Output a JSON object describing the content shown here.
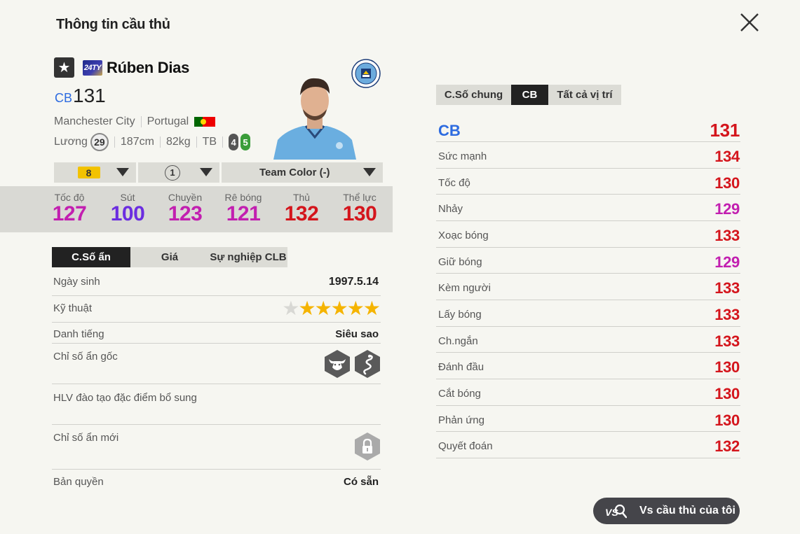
{
  "header": {
    "title": "Thông tin cầu thủ"
  },
  "player": {
    "name": "Rúben Dias",
    "season_badge": "24TY",
    "position": "CB",
    "ovr": "131",
    "club": "Manchester City",
    "nation": "Portugal",
    "salary_label": "Lương",
    "salary": "29",
    "height": "187cm",
    "weight": "82kg",
    "body_type": "TB",
    "left_foot": "4",
    "right_foot": "5"
  },
  "selectors": {
    "enhance_level": "8",
    "grade": "1",
    "team_color": "Team Color (-)"
  },
  "main_stats": [
    {
      "label": "Tốc độ",
      "value": "127",
      "color": "#c21fb0"
    },
    {
      "label": "Sút",
      "value": "100",
      "color": "#6b2de0"
    },
    {
      "label": "Chuyền",
      "value": "123",
      "color": "#c21fb0"
    },
    {
      "label": "Rê bóng",
      "value": "121",
      "color": "#c21fb0"
    },
    {
      "label": "Thủ",
      "value": "132",
      "color": "#d4151c"
    },
    {
      "label": "Thể lực",
      "value": "130",
      "color": "#d4151c"
    }
  ],
  "info_tabs": [
    "C.Số ẩn",
    "Giá",
    "Sự nghiệp CLB"
  ],
  "hidden_info": {
    "birthday_label": "Ngày sinh",
    "birthday": "1997.5.14",
    "skill_label": "Kỹ thuật",
    "skill_stars": 5,
    "fame_label": "Danh tiếng",
    "fame": "Siêu sao",
    "traits_label": "Chỉ số ẩn gốc",
    "trait_icons": [
      "bull-icon",
      "snake-icon"
    ],
    "coach_label": "HLV đào tạo đặc điểm bổ sung",
    "new_traits_label": "Chỉ số ẩn mới",
    "license_label": "Bản quyền",
    "license": "Có sẵn"
  },
  "attr_tabs": [
    "C.Số chung",
    "CB",
    "Tất cả vị trí"
  ],
  "attributes": {
    "header_label": "CB",
    "header_value": "131",
    "rows": [
      {
        "label": "Sức mạnh",
        "value": "134",
        "color": "#d4151c"
      },
      {
        "label": "Tốc độ",
        "value": "130",
        "color": "#d4151c"
      },
      {
        "label": "Nhảy",
        "value": "129",
        "color": "#c21fb0"
      },
      {
        "label": "Xoạc bóng",
        "value": "133",
        "color": "#d4151c"
      },
      {
        "label": "Giữ bóng",
        "value": "129",
        "color": "#c21fb0"
      },
      {
        "label": "Kèm người",
        "value": "133",
        "color": "#d4151c"
      },
      {
        "label": "Lấy bóng",
        "value": "133",
        "color": "#d4151c"
      },
      {
        "label": "Ch.ngắn",
        "value": "133",
        "color": "#d4151c"
      },
      {
        "label": "Đánh đầu",
        "value": "130",
        "color": "#d4151c"
      },
      {
        "label": "Cắt bóng",
        "value": "130",
        "color": "#d4151c"
      },
      {
        "label": "Phản ứng",
        "value": "130",
        "color": "#d4151c"
      },
      {
        "label": "Quyết đoán",
        "value": "132",
        "color": "#d4151c"
      }
    ]
  },
  "compare_button": {
    "label": "Vs cầu thủ của tôi"
  }
}
